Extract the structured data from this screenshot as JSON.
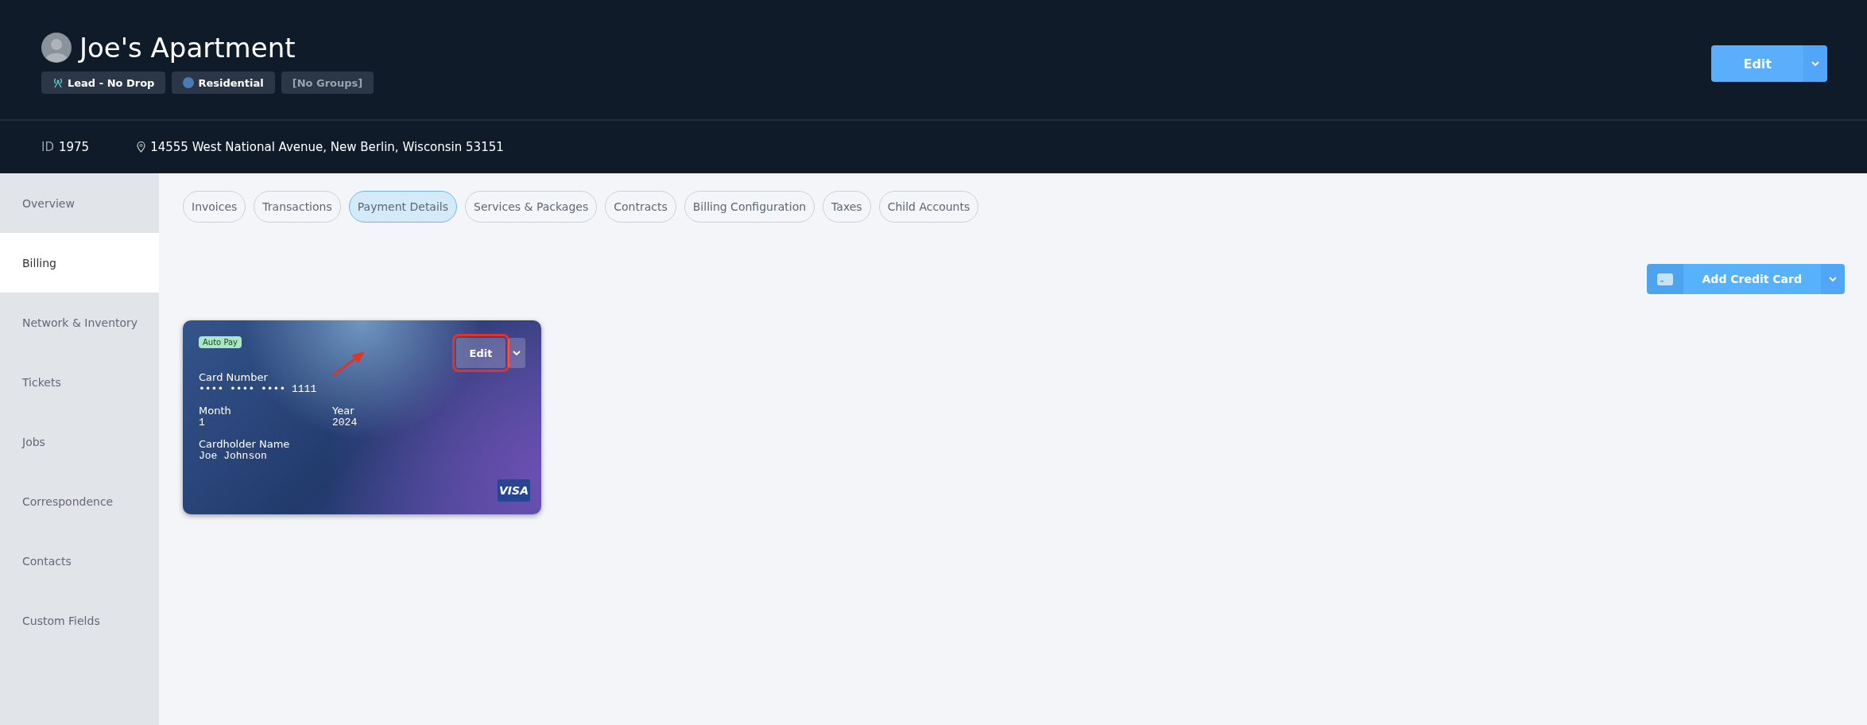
{
  "header": {
    "title": "Joe's Apartment",
    "tags": [
      {
        "kind": "status",
        "label": "Lead - No Drop"
      },
      {
        "kind": "type",
        "label": "Residential",
        "color": "#4a7bb5"
      },
      {
        "kind": "group",
        "label": "[No Groups]"
      }
    ],
    "edit_button": "Edit"
  },
  "info_bar": {
    "id_label": "ID",
    "id_value": "1975",
    "address": "14555 West National Avenue, New Berlin, Wisconsin 53151"
  },
  "sidebar": {
    "items": [
      {
        "label": "Overview",
        "selected": false
      },
      {
        "label": "Billing",
        "selected": true
      },
      {
        "label": "Network & Inventory",
        "selected": false
      },
      {
        "label": "Tickets",
        "selected": false
      },
      {
        "label": "Jobs",
        "selected": false
      },
      {
        "label": "Correspondence",
        "selected": false
      },
      {
        "label": "Contacts",
        "selected": false
      },
      {
        "label": "Custom Fields",
        "selected": false
      }
    ]
  },
  "tabs": [
    {
      "label": "Invoices",
      "selected": false
    },
    {
      "label": "Transactions",
      "selected": false
    },
    {
      "label": "Payment Details",
      "selected": true
    },
    {
      "label": "Services & Packages",
      "selected": false
    },
    {
      "label": "Contracts",
      "selected": false
    },
    {
      "label": "Billing Configuration",
      "selected": false
    },
    {
      "label": "Taxes",
      "selected": false
    },
    {
      "label": "Child Accounts",
      "selected": false
    }
  ],
  "add_card_button": "Add Credit Card",
  "cards": [
    {
      "badge": "Auto Pay",
      "edit_button": "Edit",
      "highlighted": true,
      "number_label": "Card Number",
      "number": "•••• •••• •••• 1111",
      "month_label": "Month",
      "month": "1",
      "year_label": "Year",
      "year": "2024",
      "holder_label": "Cardholder Name",
      "holder": "Joe Johnson",
      "brand": "VISA"
    }
  ]
}
